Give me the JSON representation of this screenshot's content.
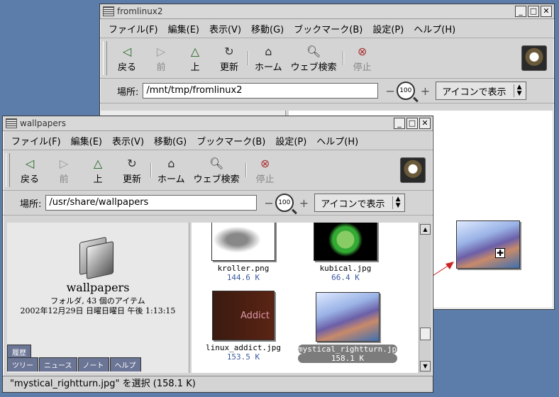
{
  "back_window": {
    "title": "fromlinux2",
    "menu": [
      "ファイル(F)",
      "編集(E)",
      "表示(V)",
      "移動(G)",
      "ブックマーク(B)",
      "設定(P)",
      "ヘルプ(H)"
    ],
    "toolbar": {
      "back": "戻る",
      "forward": "前",
      "up": "上",
      "reload": "更新",
      "home": "ホーム",
      "web_search": "ウェブ検索",
      "stop": "停止"
    },
    "location_label": "場所:",
    "location_value": "/mnt/tmp/fromlinux2",
    "zoom": "100",
    "view_mode": "アイコンで表示"
  },
  "front_window": {
    "title": "wallpapers",
    "menu": [
      "ファイル(F)",
      "編集(E)",
      "表示(V)",
      "移動(G)",
      "ブックマーク(B)",
      "設定(P)",
      "ヘルプ(H)"
    ],
    "toolbar": {
      "back": "戻る",
      "forward": "前",
      "up": "上",
      "reload": "更新",
      "home": "ホーム",
      "web_search": "ウェブ検索",
      "stop": "停止"
    },
    "location_label": "場所:",
    "location_value": "/usr/share/wallpapers",
    "zoom": "100",
    "view_mode": "アイコンで表示",
    "sidebar": {
      "folder_name": "wallpapers",
      "info": "フォルダ, 43 個のアイテム",
      "date": "2002年12月29日 日曜日曜日 午後 1:13:15",
      "tab_top": "履歴",
      "tabs": [
        "ツリー",
        "ニュース",
        "ノート",
        "ヘルプ"
      ]
    },
    "files": [
      {
        "name": "kroller.png",
        "size": "144.6 K"
      },
      {
        "name": "kubical.jpg",
        "size": "66.4 K"
      },
      {
        "name": "linux_addict.jpg",
        "size": "153.5 K",
        "thumb_text": "Addict"
      },
      {
        "name": "mystical_rightturn.jpg",
        "size": "158.1 K",
        "selected": true
      }
    ],
    "status": "\"mystical_rightturn.jpg\" を選択 (158.1 K)"
  },
  "colors": {
    "desktop": "#5c7caa",
    "window": "#d4d4d4",
    "selection": "#7c7c7c",
    "size_text": "#3c5aa0",
    "drag_arrow": "#cc2222"
  }
}
